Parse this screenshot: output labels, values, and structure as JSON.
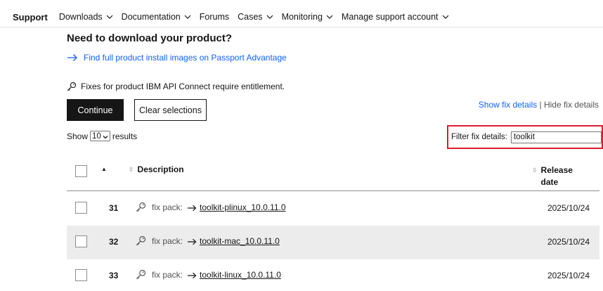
{
  "nav": {
    "brand": "Support",
    "items": [
      {
        "label": "Downloads",
        "dropdown": true
      },
      {
        "label": "Documentation",
        "dropdown": true
      },
      {
        "label": "Forums",
        "dropdown": false
      },
      {
        "label": "Cases",
        "dropdown": true
      },
      {
        "label": "Monitoring",
        "dropdown": true
      },
      {
        "label": "Manage support account",
        "dropdown": true
      }
    ]
  },
  "header": {
    "title": "Need to download your product?",
    "pa_link": "Find full product install images on Passport Advantage"
  },
  "entitlement_note": "Fixes for product IBM API Connect require entitlement.",
  "buttons": {
    "continue": "Continue",
    "clear": "Clear selections"
  },
  "fix_details": {
    "show": "Show fix details",
    "separator": "|",
    "hide": "Hide fix details"
  },
  "results": {
    "prefix": "Show",
    "value": "10",
    "suffix": "results"
  },
  "filter": {
    "label": "Filter fix details:",
    "value": "toolkit"
  },
  "table": {
    "headers": {
      "sort_indicator": "▲",
      "description": "Description",
      "release_date": "Release date"
    },
    "rows": [
      {
        "num": "31",
        "type": "fix pack:",
        "name": "toolkit-plinux_10.0.11.0",
        "date": "2025/10/24"
      },
      {
        "num": "32",
        "type": "fix pack:",
        "name": "toolkit-mac_10.0.11.0",
        "date": "2025/10/24"
      },
      {
        "num": "33",
        "type": "fix pack:",
        "name": "toolkit-linux_10.0.11.0",
        "date": "2025/10/24"
      }
    ]
  },
  "colors": {
    "accent_link": "#0f62fe",
    "primary_button": "#161616",
    "highlight_box": "#e01b2f",
    "row_alt": "#ececec"
  }
}
